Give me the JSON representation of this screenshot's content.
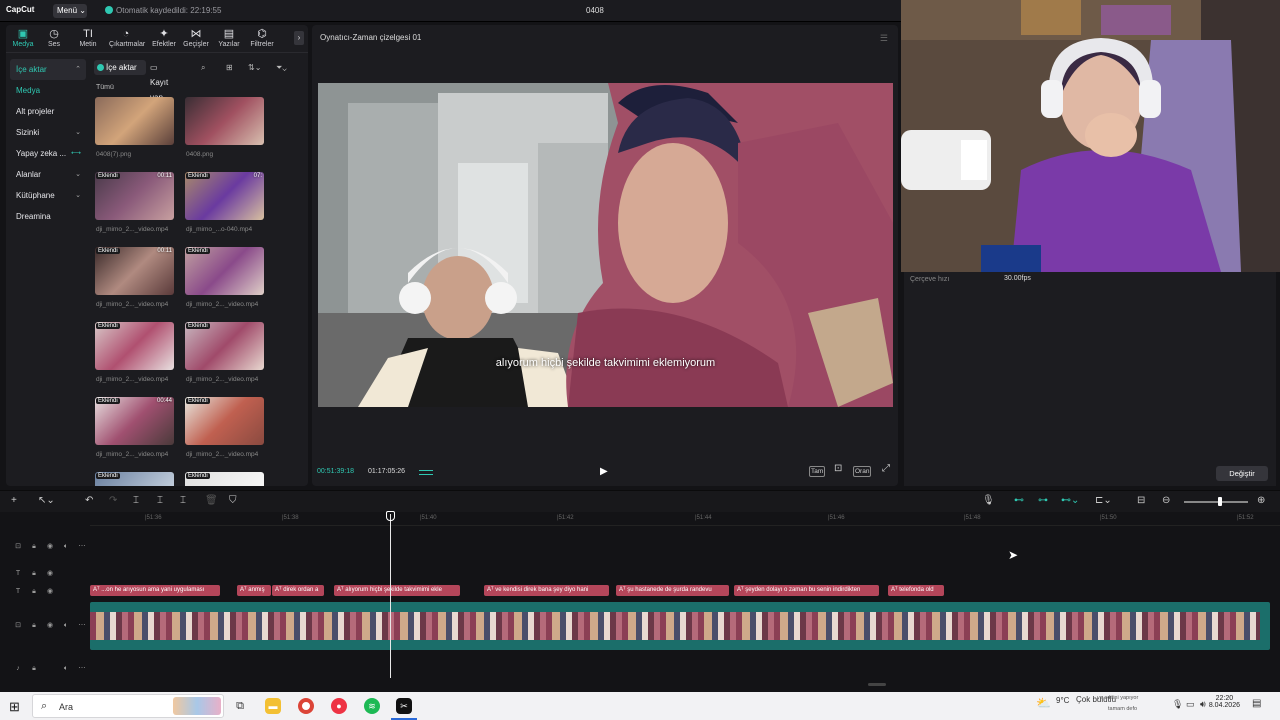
{
  "app": {
    "logo": "CapCut",
    "menu_label": "Menü",
    "menu_chevron": "⌄",
    "autosave": "Otomatik kaydedildi: 22:19:55",
    "project_title": "0408"
  },
  "tabs": [
    {
      "label": "Medya",
      "icon": "▣"
    },
    {
      "label": "Ses",
      "icon": "◷"
    },
    {
      "label": "Metin",
      "icon": "TI"
    },
    {
      "label": "Çıkartmalar",
      "icon": "◔"
    },
    {
      "label": "Efektler",
      "icon": "✦"
    },
    {
      "label": "Geçişler",
      "icon": "⋈"
    },
    {
      "label": "Yazılar",
      "icon": "▤"
    },
    {
      "label": "Filtreler",
      "icon": "⌬"
    }
  ],
  "tabs_more": "›",
  "sidenav": [
    {
      "label": "İçe aktar",
      "chev": "⌃"
    },
    {
      "label": "Medya",
      "chev": ""
    },
    {
      "label": "Alt projeler",
      "chev": ""
    },
    {
      "label": "Sizinki",
      "chev": "⌄"
    },
    {
      "label": "Yapay zeka ...",
      "chev": "⟷"
    },
    {
      "label": "Alanlar",
      "chev": "⌄"
    },
    {
      "label": "Kütüphane",
      "chev": "⌄"
    },
    {
      "label": "Dreamina",
      "chev": ""
    }
  ],
  "media_toolbar": {
    "import": "İçe aktar",
    "record": "Kayıt yap",
    "all": "Tümü"
  },
  "media_items": [
    {
      "name": "0408(7).png",
      "badge": "",
      "duration": ""
    },
    {
      "name": "0408.png",
      "badge": "",
      "duration": ""
    },
    {
      "name": "dji_mimo_2..._video.mp4",
      "badge": "Eklendi",
      "duration": "00:11"
    },
    {
      "name": "dji_mimo_...o-040.mp4",
      "badge": "Eklendi",
      "duration": "07:"
    },
    {
      "name": "dji_mimo_2..._video.mp4",
      "badge": "Eklendi",
      "duration": "00:11"
    },
    {
      "name": "dji_mimo_2..._video.mp4",
      "badge": "Eklendi",
      "duration": ""
    },
    {
      "name": "dji_mimo_2..._video.mp4",
      "badge": "Eklendi",
      "duration": ""
    },
    {
      "name": "dji_mimo_2..._video.mp4",
      "badge": "Eklendi",
      "duration": ""
    },
    {
      "name": "dji_mimo_2..._video.mp4",
      "badge": "Eklendi",
      "duration": "00:44"
    },
    {
      "name": "dji_mimo_2..._video.mp4",
      "badge": "Eklendi",
      "duration": ""
    },
    {
      "name": "",
      "badge": "Eklendi",
      "duration": ""
    },
    {
      "name": "",
      "badge": "Eklendi",
      "duration": ""
    }
  ],
  "player": {
    "title": "Oynatıcı-Zaman çizelgesi 01",
    "subtitle": "alıyorum hiçbi şekilde takvimimi eklemiyorum",
    "current_time": "00:51:39:18",
    "total_time": "01:17:05:26",
    "full_label": "Tam",
    "ratio_label": "Oran"
  },
  "properties": {
    "frame_rate_label": "Çerçeve hızı",
    "frame_rate_value": "30.00fps",
    "change_button": "Değiştir"
  },
  "ruler_ticks": [
    "|51:36",
    "|51:38",
    "|51:40",
    "|51:42",
    "|51:44",
    "|51:46",
    "|51:48",
    "|51:50",
    "|51:52"
  ],
  "captions": [
    {
      "text": "Aᵀ ...on he arıyosun ama yani uygulaması"
    },
    {
      "text": "Aᵀ anmış"
    },
    {
      "text": "Aᵀ direk ordan a"
    },
    {
      "text": "Aᵀ alıyorum hiçbi şekilde takvimimi ekle"
    },
    {
      "text": "Aᵀ ve kendisi direk bana şey diyo hani"
    },
    {
      "text": "Aᵀ şu hastanede de şurda randevu"
    },
    {
      "text": "Aᵀ şeyden dolayı o zaman bu senin indirdikten"
    },
    {
      "text": "Aᵀ telefonda old"
    }
  ],
  "taskbar": {
    "search_placeholder": "Ara",
    "weather": "9°C",
    "weather_desc": "Çok bulutlu",
    "tray_text1": "ve editini yapıyor",
    "tray_text2": "tamam defo",
    "time": "22:20",
    "date": "8.04.2026"
  },
  "colors": {
    "accent": "#2fc8b2",
    "caption": "#b4465a",
    "track": "#1b6e6a"
  }
}
